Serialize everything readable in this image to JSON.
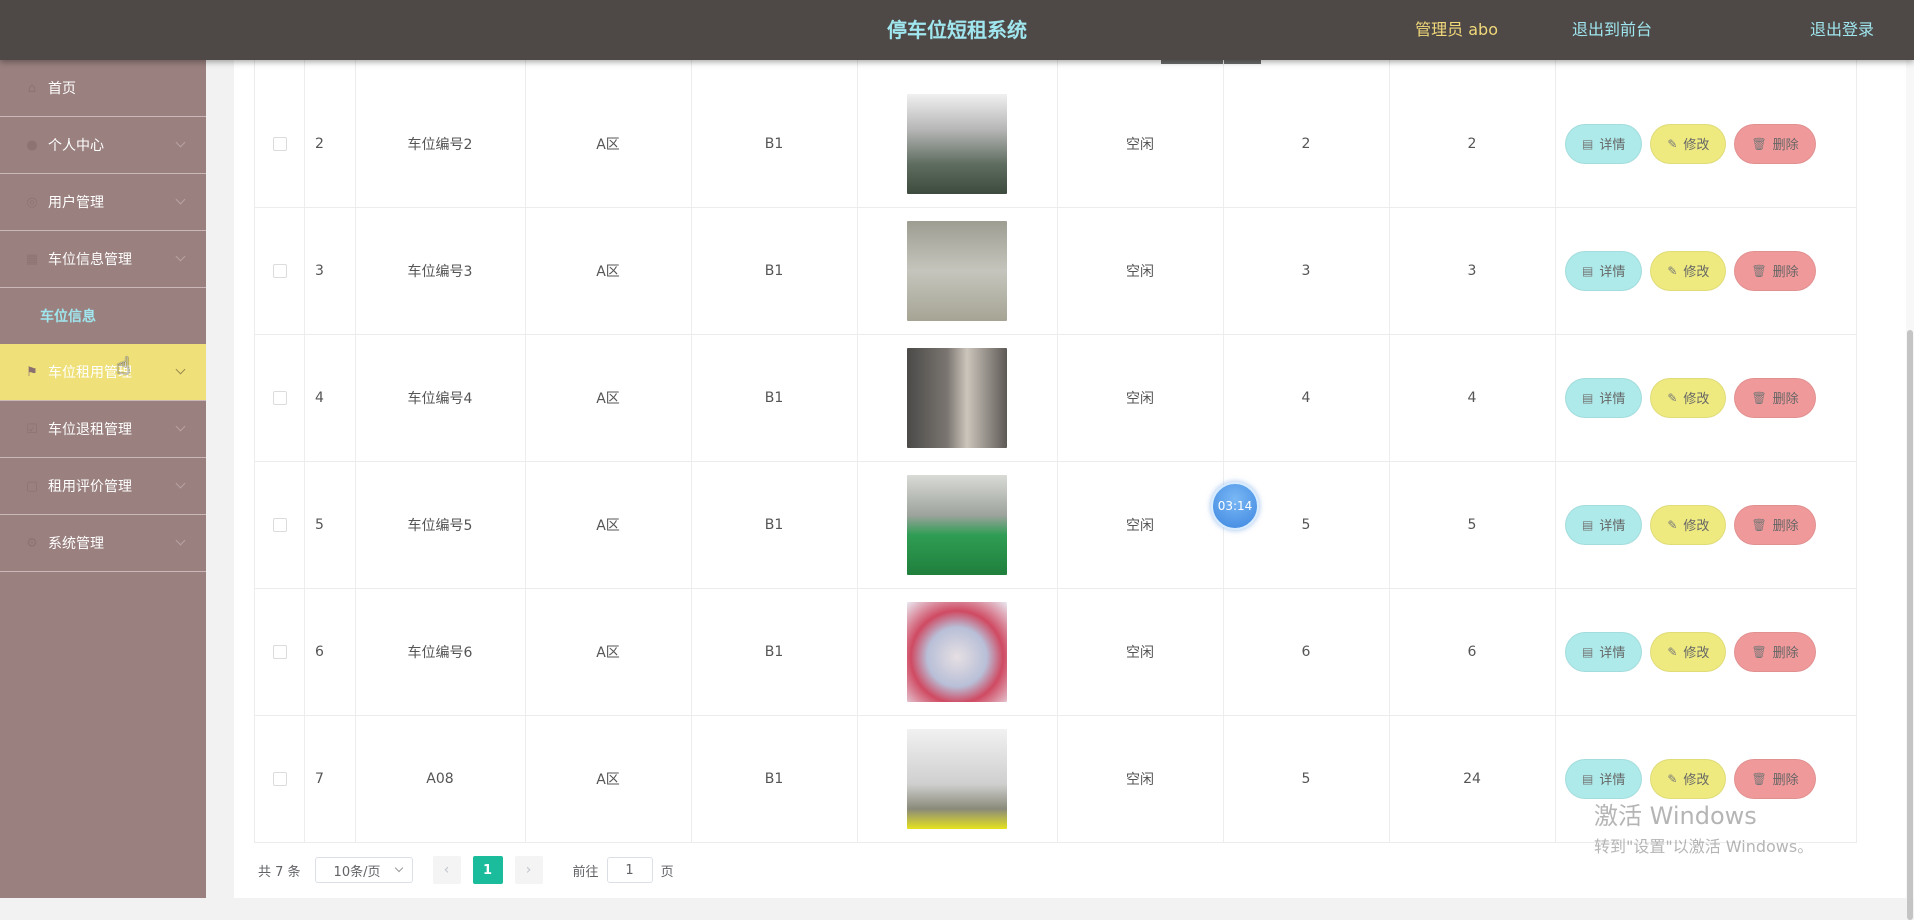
{
  "header": {
    "title": "停车位短租系统",
    "user": "管理员 abo",
    "front_link": "退出到前台",
    "logout_link": "退出登录"
  },
  "sidebar": {
    "items": [
      {
        "label": "首页",
        "icon": "home-icon"
      },
      {
        "label": "个人中心",
        "icon": "user-icon"
      },
      {
        "label": "用户管理",
        "icon": "users-icon"
      },
      {
        "label": "车位信息管理",
        "icon": "list-icon"
      },
      {
        "label": "车位信息",
        "icon": ""
      },
      {
        "label": "车位租用管理",
        "icon": "flag-icon"
      },
      {
        "label": "车位退租管理",
        "icon": "return-icon"
      },
      {
        "label": "租用评价管理",
        "icon": "comment-icon"
      },
      {
        "label": "系统管理",
        "icon": "settings-icon"
      }
    ]
  },
  "table": {
    "rows": [
      {
        "index": "2",
        "code": "车位编号2",
        "area": "A区",
        "floor": "B1",
        "status": "空闲",
        "col7": "2",
        "col8": "2",
        "image": "parking-photo-2"
      },
      {
        "index": "3",
        "code": "车位编号3",
        "area": "A区",
        "floor": "B1",
        "status": "空闲",
        "col7": "3",
        "col8": "3",
        "image": "parking-photo-3"
      },
      {
        "index": "4",
        "code": "车位编号4",
        "area": "A区",
        "floor": "B1",
        "status": "空闲",
        "col7": "4",
        "col8": "4",
        "image": "parking-photo-4"
      },
      {
        "index": "5",
        "code": "车位编号5",
        "area": "A区",
        "floor": "B1",
        "status": "空闲",
        "col7": "5",
        "col8": "5",
        "image": "parking-photo-5"
      },
      {
        "index": "6",
        "code": "车位编号6",
        "area": "A区",
        "floor": "B1",
        "status": "空闲",
        "col7": "6",
        "col8": "6",
        "image": "parking-photo-6"
      },
      {
        "index": "7",
        "code": "A08",
        "area": "A区",
        "floor": "B1",
        "status": "空闲",
        "col7": "5",
        "col8": "24",
        "image": "parking-photo-7"
      }
    ],
    "actions": {
      "detail": "详情",
      "edit": "修改",
      "delete": "删除"
    }
  },
  "pagination": {
    "total": "共 7 条",
    "page_size": "10条/页",
    "current_page": "1",
    "goto_label": "前往",
    "goto_value": "1",
    "page_unit": "页"
  },
  "timer": {
    "text": "03:14"
  },
  "watermark": {
    "line1": "激活 Windows",
    "line2": "转到\"设置\"以激活 Windows。"
  },
  "colors": {
    "header_bg": "#4e4847",
    "sidebar_bg": "#9a807f",
    "active_menu": "#efe07a",
    "title": "#9fe6ee",
    "detail_btn": "#aeeaea",
    "edit_btn": "#eeea80",
    "delete_btn": "#f0999a",
    "page_active": "#1bbc9b"
  }
}
